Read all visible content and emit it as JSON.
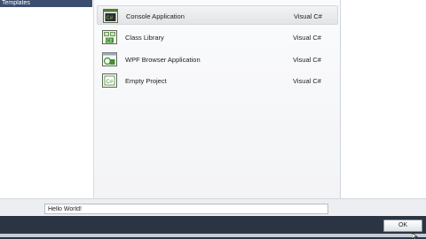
{
  "sidebar": {
    "header": "Templates"
  },
  "templates": [
    {
      "name": "Console Application",
      "language": "Visual C#",
      "icon": "console-application-icon",
      "selected": true
    },
    {
      "name": "Class Library",
      "language": "Visual C#",
      "icon": "class-library-icon",
      "selected": false
    },
    {
      "name": "WPF Browser Application",
      "language": "Visual C#",
      "icon": "wpf-browser-application-icon",
      "selected": false
    },
    {
      "name": "Empty Project",
      "language": "Visual C#",
      "icon": "empty-project-icon",
      "selected": false
    }
  ],
  "name_field": {
    "value": "Hello World!"
  },
  "footer": {
    "ok_label": "OK"
  },
  "colors": {
    "accent_green": "#3f8f2f",
    "header_bg": "#3c4e6e",
    "footer_bg": "#2b3442"
  }
}
